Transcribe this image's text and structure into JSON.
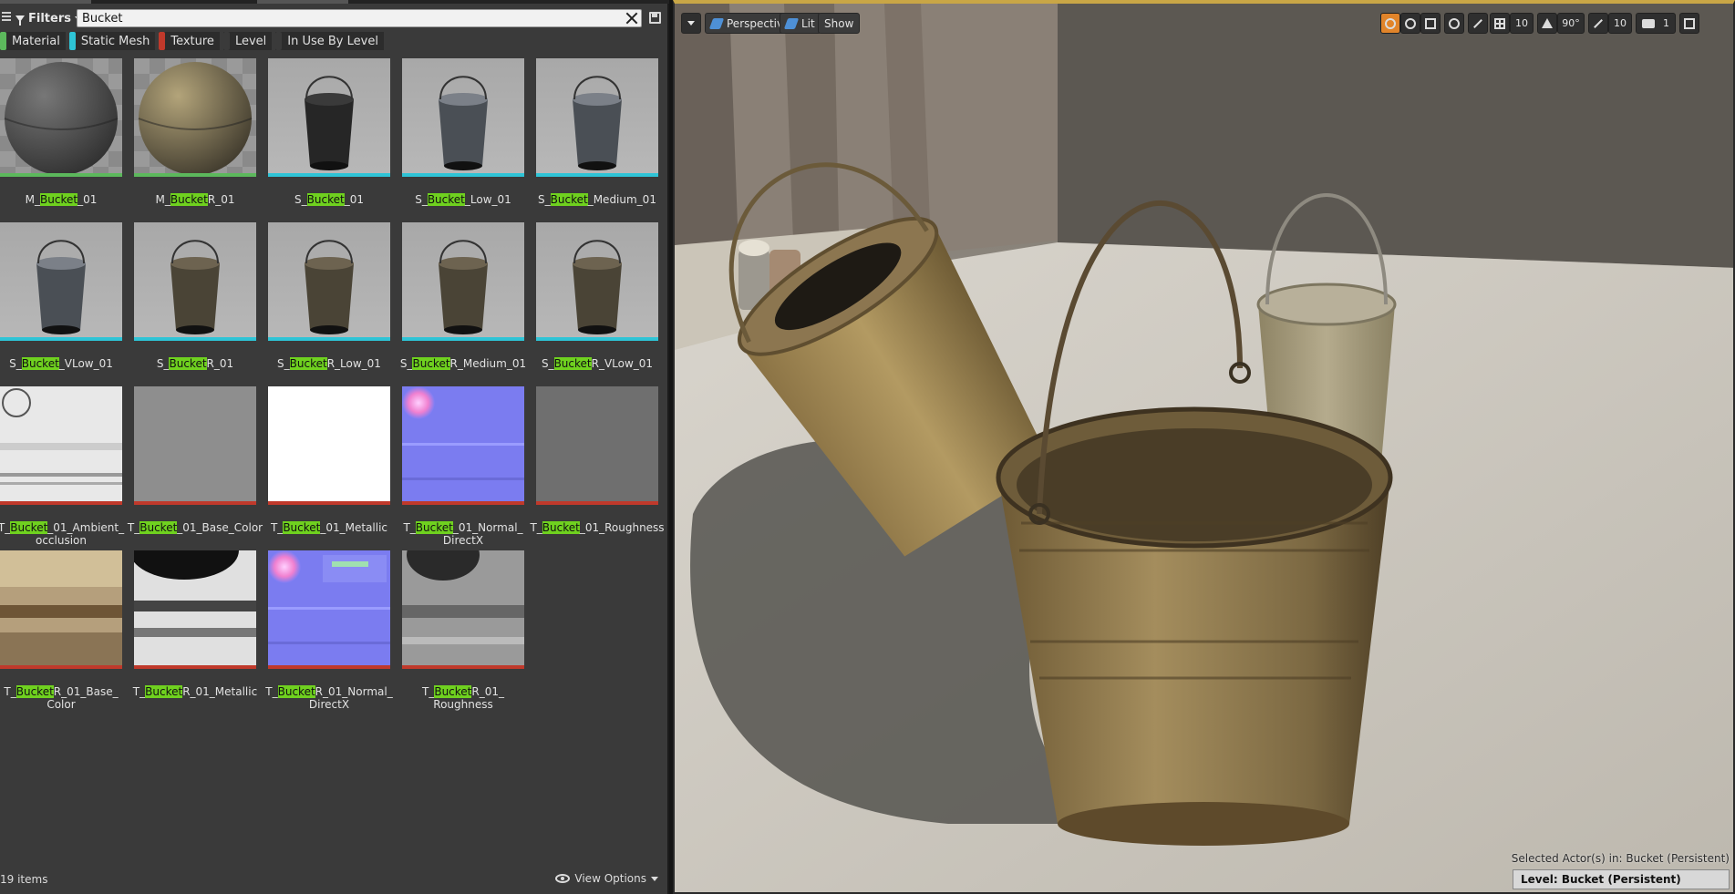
{
  "browser": {
    "filters_label": "Filters",
    "search_value": "Bucket",
    "chips": [
      {
        "label": "Material",
        "color": "#5cb85c"
      },
      {
        "label": "Static Mesh",
        "color": "#2ec4d6"
      },
      {
        "label": "Texture",
        "color": "#c0392b"
      },
      {
        "label": "Level",
        "color": "#3a3a3a"
      },
      {
        "label": "In Use By Level",
        "color": "#3a3a3a"
      }
    ],
    "assets": [
      {
        "pre": "M_",
        "hl": "Bucket",
        "post": "_01",
        "thumb": "ball-dark",
        "bar": "#5cb85c"
      },
      {
        "pre": "M_",
        "hl": "Bucket",
        "post": "R_01",
        "thumb": "ball-rust",
        "bar": "#5cb85c"
      },
      {
        "pre": "S_",
        "hl": "Bucket",
        "post": "_01",
        "thumb": "bucket-black",
        "bar": "#2ec4d6"
      },
      {
        "pre": "S_",
        "hl": "Bucket",
        "post": "_Low_01",
        "thumb": "bucket-grey",
        "bar": "#2ec4d6"
      },
      {
        "pre": "S_",
        "hl": "Bucket",
        "post": "_Medium_01",
        "thumb": "bucket-grey",
        "bar": "#2ec4d6"
      },
      {
        "pre": "S_",
        "hl": "Bucket",
        "post": "_VLow_01",
        "thumb": "bucket-grey",
        "bar": "#2ec4d6"
      },
      {
        "pre": "S_",
        "hl": "Bucket",
        "post": "R_01",
        "thumb": "bucket-rust",
        "bar": "#2ec4d6"
      },
      {
        "pre": "S_",
        "hl": "Bucket",
        "post": "R_Low_01",
        "thumb": "bucket-rust",
        "bar": "#2ec4d6"
      },
      {
        "pre": "S_",
        "hl": "Bucket",
        "post": "R_Medium_01",
        "thumb": "bucket-rust",
        "bar": "#2ec4d6"
      },
      {
        "pre": "S_",
        "hl": "Bucket",
        "post": "R_VLow_01",
        "thumb": "bucket-rust",
        "bar": "#2ec4d6"
      },
      {
        "pre": "T_",
        "hl": "Bucket",
        "post": "_01_Ambient_\nocclusion",
        "thumb": "tex-ao",
        "bar": "#c0392b"
      },
      {
        "pre": "T_",
        "hl": "Bucket",
        "post": "_01_Base_Color",
        "thumb": "tex-grey",
        "bar": "#c0392b"
      },
      {
        "pre": "T_",
        "hl": "Bucket",
        "post": "_01_Metallic",
        "thumb": "tex-white",
        "bar": "#c0392b"
      },
      {
        "pre": "T_",
        "hl": "Bucket",
        "post": "_01_Normal_\nDirectX",
        "thumb": "tex-normal",
        "bar": "#c0392b"
      },
      {
        "pre": "T_",
        "hl": "Bucket",
        "post": "_01_Roughness",
        "thumb": "tex-darkgrey",
        "bar": "#c0392b"
      },
      {
        "pre": "T_",
        "hl": "Bucket",
        "post": "R_01_Base_\nColor",
        "thumb": "tex-rust",
        "bar": "#c0392b"
      },
      {
        "pre": "T_",
        "hl": "Bucket",
        "post": "R_01_Metallic",
        "thumb": "tex-metal",
        "bar": "#c0392b"
      },
      {
        "pre": "T_",
        "hl": "Bucket",
        "post": "R_01_Normal_\nDirectX",
        "thumb": "tex-normal2",
        "bar": "#c0392b"
      },
      {
        "pre": "T_",
        "hl": "Bucket",
        "post": "R_01_\nRoughness",
        "thumb": "tex-rough",
        "bar": "#c0392b"
      }
    ],
    "highlight_color": "#6fd11f",
    "item_count": "19 items",
    "view_options": "View Options"
  },
  "viewport": {
    "perspective": "Perspective",
    "lit": "Lit",
    "show": "Show",
    "grid_snap": "10",
    "rotation_snap": "90°",
    "scale_snap": "10",
    "camera_speed": "1",
    "selected_actors": "Selected Actor(s) in:  Bucket (Persistent)",
    "level": "Level:  Bucket (Persistent)",
    "accent": "#e1842a"
  }
}
